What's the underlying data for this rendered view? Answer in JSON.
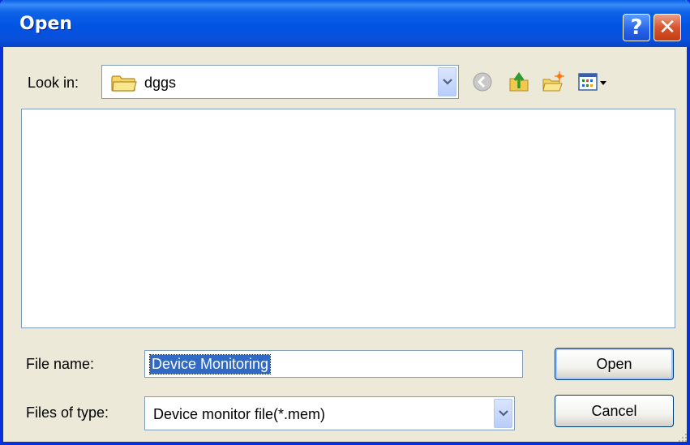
{
  "window": {
    "title": "Open"
  },
  "caption_buttons": {
    "help": "?",
    "close": "✕"
  },
  "lookin": {
    "label": "Look in:",
    "value": "dggs",
    "icon": "folder-icon"
  },
  "toolbar": {
    "icons": [
      "back-icon",
      "up-folder-icon",
      "new-folder-icon",
      "view-menu-icon"
    ]
  },
  "filename": {
    "label": "File name:",
    "value": "Device Monitoring"
  },
  "filetype": {
    "label": "Files of type:",
    "value": "Device monitor file(*.mem)"
  },
  "buttons": {
    "open": "Open",
    "cancel": "Cancel"
  },
  "colors": {
    "titlebar": "#0054e3",
    "dialog_bg": "#ece9d8",
    "selection": "#316ac5",
    "border": "#7f9db9"
  }
}
